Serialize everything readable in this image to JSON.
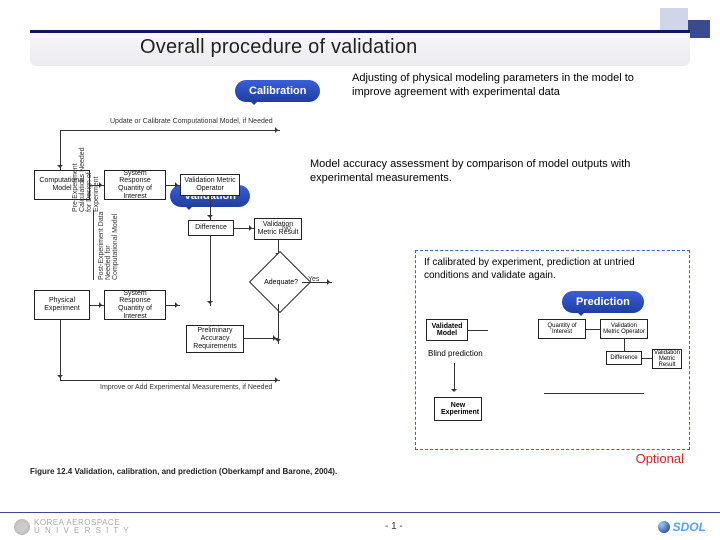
{
  "title": "Overall procedure of validation",
  "bubbles": {
    "calibration": "Calibration",
    "validation": "Validation",
    "prediction": "Prediction"
  },
  "descriptions": {
    "calibration": "Adjusting of physical modeling parameters in the model to improve agreement with experimental data",
    "validation": "Model accuracy assessment by comparison of model outputs with experimental measurements.",
    "prediction": "If calibrated by experiment, prediction at untried conditions and validate again."
  },
  "diagram": {
    "top_feedback": "Update or Calibrate Computational Model, if Needed",
    "bottom_feedback": "Improve or Add Experimental Measurements, if Needed",
    "boxes": {
      "comp_model": "Computational Model",
      "sys_response_1": "System Response Quantity of Interest",
      "val_metric": "Validation Metric Operator",
      "difference": "Difference",
      "val_result": "Validation Metric Result",
      "adequate": "Adequate?",
      "phys_exp": "Physical Experiment",
      "sys_response_2": "System Response Quantity of Interest",
      "prelim_req": "Preliminary Accuracy Requirements",
      "side_left": "Pre-Experiment Calculations Needed for Design of Experiment",
      "side_right": "Post-Experiment Data Needed for Computational Model"
    },
    "labels": {
      "yes": "Yes",
      "no": "No"
    }
  },
  "mini_diagram": {
    "validated_model": "Validated Model",
    "qoi": "Quantity of Interest",
    "metric_op": "Validation Metric Operator",
    "diff": "Difference",
    "metric_res": "Validation Metric Result",
    "blind": "Blind prediction",
    "new_exp": "New Experiment"
  },
  "caption": "Figure 12.4 Validation, calibration, and prediction (Oberkampf and Barone, 2004).",
  "optional_label": "Optional",
  "footer": {
    "uni_top": "KOREA AEROSPACE",
    "uni_bottom": "U N I V E R S I T Y",
    "page": "-  1  -",
    "brand": "SDOL"
  }
}
